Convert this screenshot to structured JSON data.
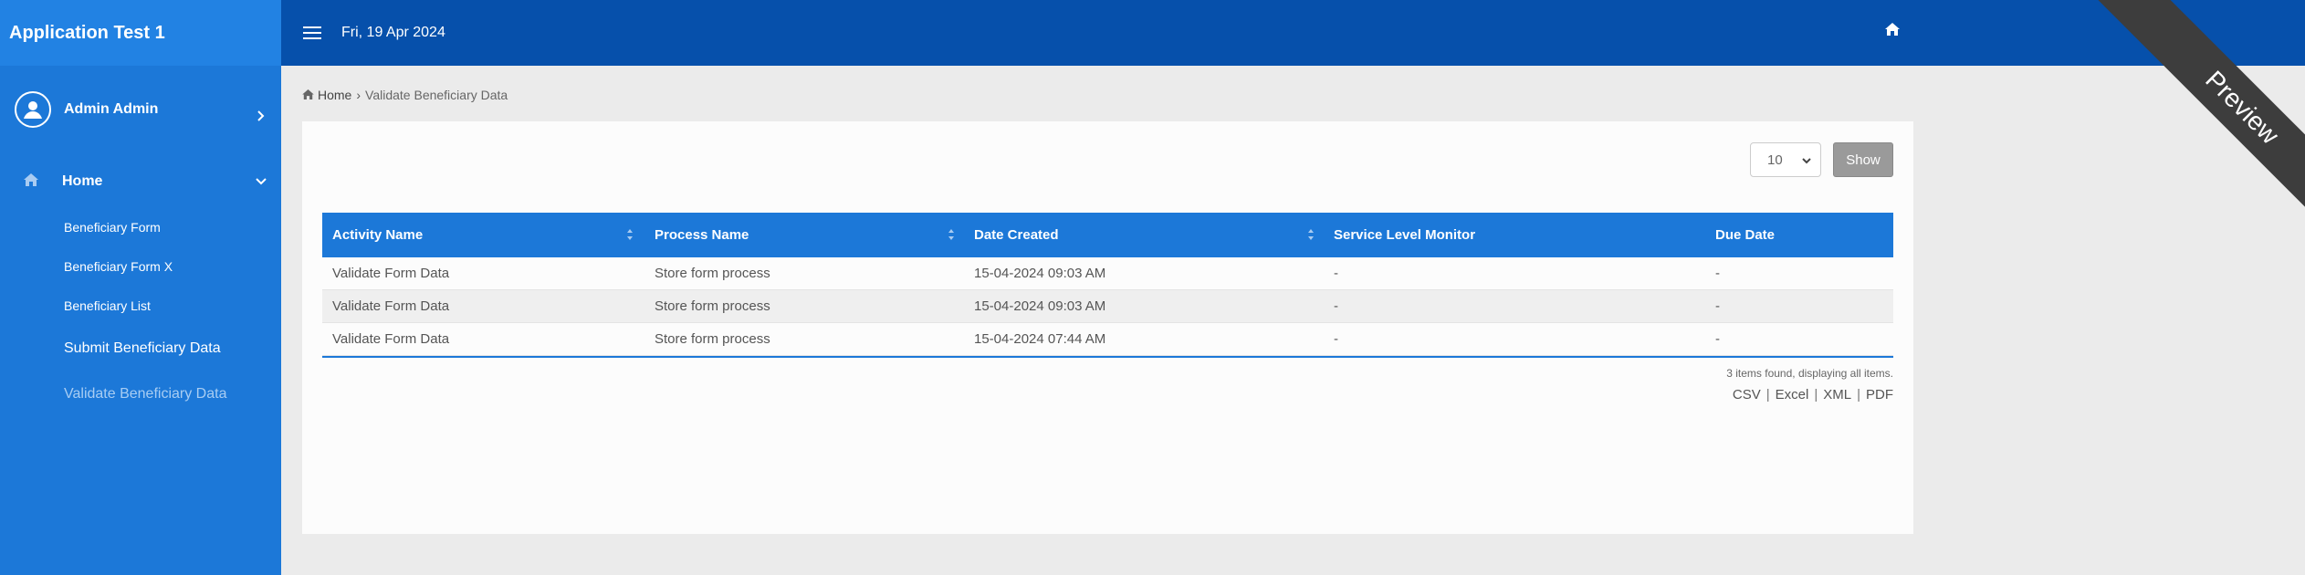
{
  "app": {
    "title": "Application Test 1"
  },
  "user": {
    "name": "Admin Admin"
  },
  "menu": {
    "home_label": "Home",
    "items": [
      {
        "label": "Beneficiary Form"
      },
      {
        "label": "Beneficiary Form X"
      },
      {
        "label": "Beneficiary List"
      },
      {
        "label": "Submit Beneficiary Data"
      },
      {
        "label": "Validate Beneficiary Data"
      }
    ]
  },
  "header": {
    "date": "Fri, 19 Apr 2024"
  },
  "ribbon": {
    "label": "Preview"
  },
  "breadcrumb": {
    "home": "Home",
    "current": "Validate Beneficiary Data"
  },
  "controls": {
    "page_size": "10",
    "show_label": "Show"
  },
  "table": {
    "columns": [
      "Activity Name",
      "Process Name",
      "Date Created",
      "Service Level Monitor",
      "Due Date"
    ],
    "rows": [
      [
        "Validate Form Data",
        "Store form process",
        "15-04-2024 09:03 AM",
        "-",
        "-"
      ],
      [
        "Validate Form Data",
        "Store form process",
        "15-04-2024 09:03 AM",
        "-",
        "-"
      ],
      [
        "Validate Form Data",
        "Store form process",
        "15-04-2024 07:44 AM",
        "-",
        "-"
      ]
    ],
    "summary": "3 items found, displaying all items."
  },
  "exports": {
    "csv": "CSV",
    "excel": "Excel",
    "xml": "XML",
    "pdf": "PDF"
  },
  "colors": {
    "sidebar": "#1c78d8",
    "header": "#0650ab",
    "table_header": "#1c78d8",
    "ribbon": "#3d3d3d"
  }
}
